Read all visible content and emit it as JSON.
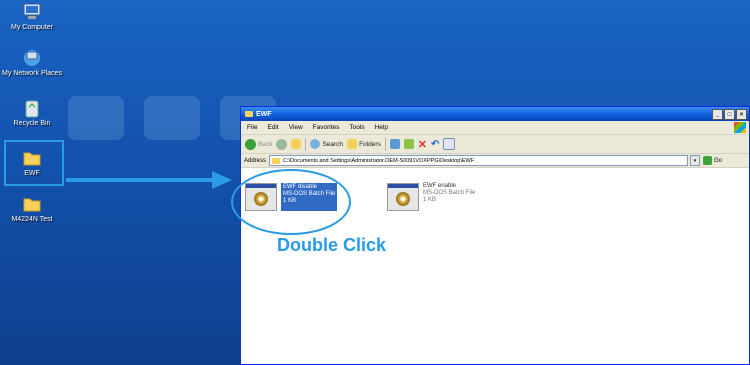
{
  "desktop": {
    "icons": [
      {
        "label": "My Computer"
      },
      {
        "label": "My Network Places"
      },
      {
        "label": "Recycle Bin"
      },
      {
        "label": "EWF"
      },
      {
        "label": "M4224N Test"
      }
    ]
  },
  "window": {
    "title": "EWF",
    "controls": {
      "minimize": "_",
      "maximize": "□",
      "close": "×"
    },
    "menu": [
      "File",
      "Edit",
      "View",
      "Favorites",
      "Tools",
      "Help"
    ],
    "toolbar": {
      "back": "Back",
      "search": "Search",
      "folders": "Folders"
    },
    "address": {
      "label": "Address",
      "path": "C:\\Documents and Settings\\Administrator.OEM-S0091VOXPPG\\Desktop\\EWF",
      "go": "Go"
    },
    "files": [
      {
        "name": "EWF disable",
        "type": "MS-DOS Batch File",
        "size": "1 KB",
        "selected": true
      },
      {
        "name": "EWF enable",
        "type": "MS-DOS Batch File",
        "size": "1 KB",
        "selected": false
      }
    ]
  },
  "annotation": {
    "text": "Double Click",
    "color": "#2a9be6"
  }
}
